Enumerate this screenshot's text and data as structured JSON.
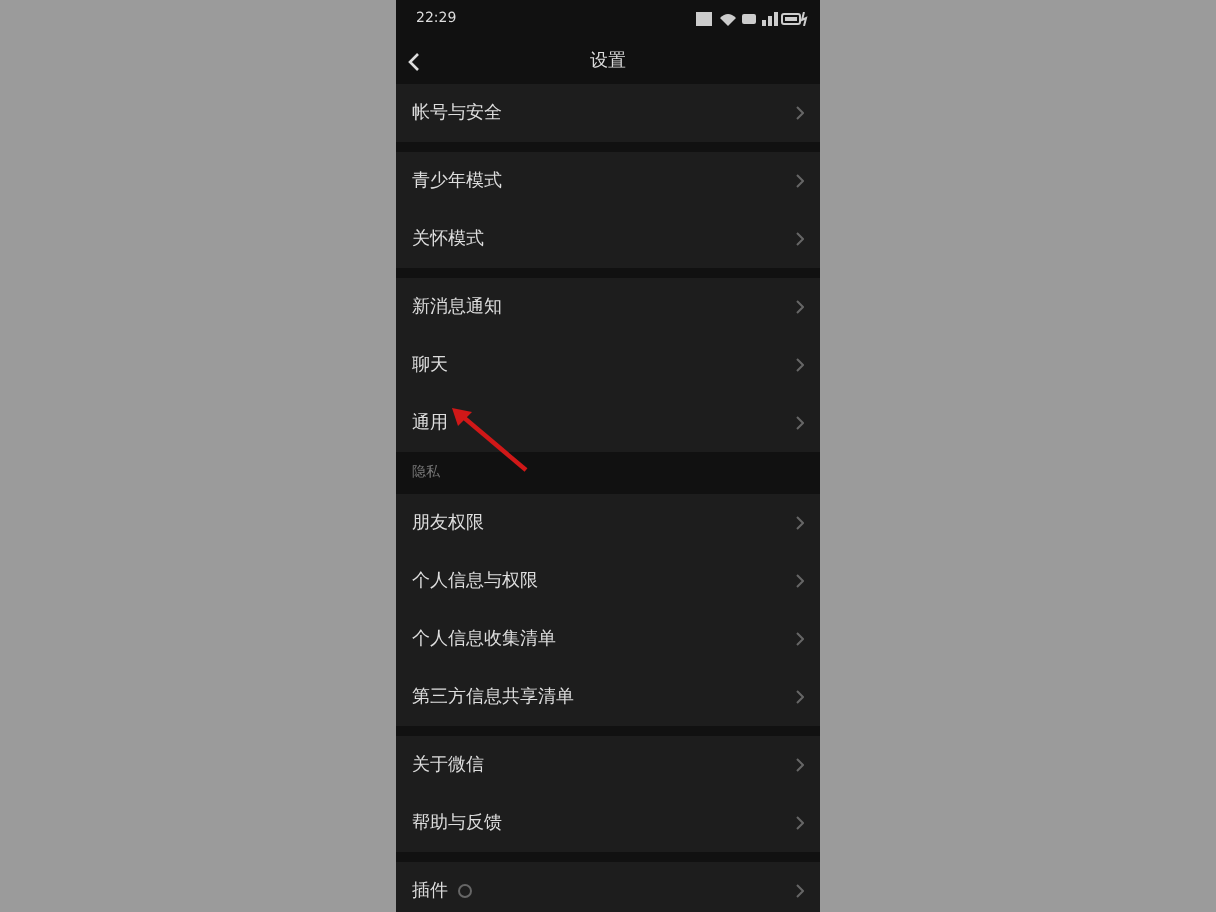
{
  "status_bar": {
    "time": "22:29"
  },
  "header": {
    "title": "设置"
  },
  "sections": [
    {
      "kind": "group",
      "items": [
        {
          "label": "帐号与安全"
        }
      ]
    },
    {
      "kind": "group",
      "items": [
        {
          "label": "青少年模式"
        },
        {
          "label": "关怀模式"
        }
      ]
    },
    {
      "kind": "group",
      "items": [
        {
          "label": "新消息通知"
        },
        {
          "label": "聊天"
        },
        {
          "label": "通用",
          "annotated": true
        }
      ]
    },
    {
      "kind": "label",
      "text": "隐私"
    },
    {
      "kind": "group",
      "items": [
        {
          "label": "朋友权限"
        },
        {
          "label": "个人信息与权限"
        },
        {
          "label": "个人信息收集清单"
        },
        {
          "label": "第三方信息共享清单"
        }
      ]
    },
    {
      "kind": "group",
      "items": [
        {
          "label": "关于微信"
        },
        {
          "label": "帮助与反馈"
        }
      ]
    },
    {
      "kind": "group",
      "items": [
        {
          "label": "插件",
          "badge": true
        }
      ]
    }
  ]
}
